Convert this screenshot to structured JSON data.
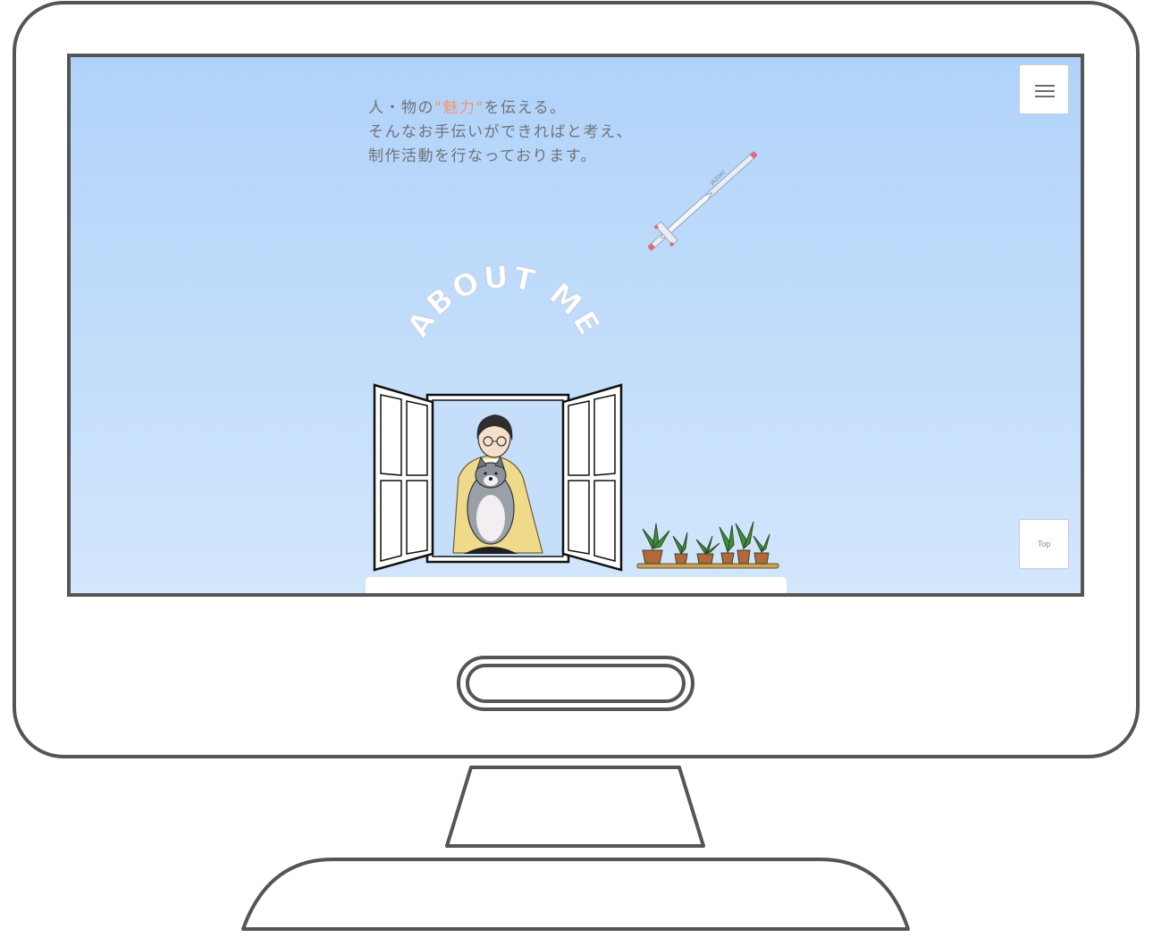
{
  "tagline": {
    "line1_prefix": "人・物の",
    "line1_accent": "\"魅力\"",
    "line1_suffix": "を伝える。",
    "line2": "そんなお手伝いができればと考え、",
    "line3": "制作活動を行なっております。"
  },
  "about_title": "ABOUT ME",
  "glider_label": "JA20KC",
  "top_button_label": "Top",
  "colors": {
    "sky_top": "#b0d2fa",
    "sky_bottom": "#d2e6fc",
    "accent": "#f3956f",
    "text": "#6f7378",
    "monitor_outline": "#555555"
  },
  "icons": {
    "menu": "hamburger-icon",
    "glider": "glider-illustration",
    "person": "person-with-dog-illustration",
    "plants": "potted-plants-illustration"
  }
}
